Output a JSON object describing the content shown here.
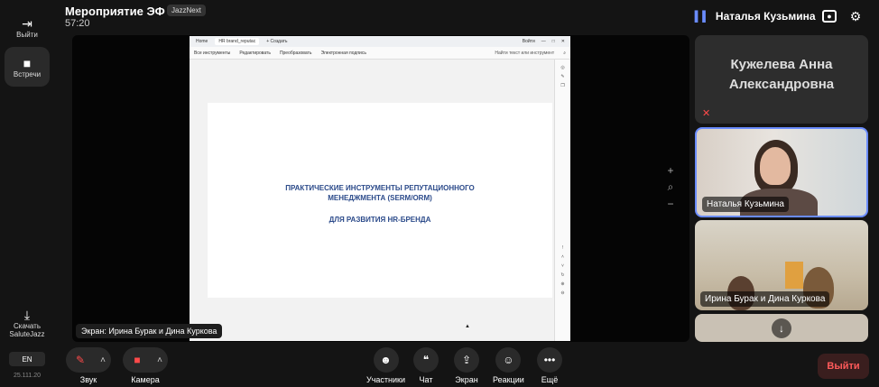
{
  "sidebar": {
    "exit_label": "Выйти",
    "meetings_label": "Встречи",
    "download_label": "Скачать SaluteJazz",
    "language": "EN",
    "version": "25.111.20"
  },
  "header": {
    "title": "Мероприятие ЭФ МГУ",
    "badge": "JazzNext",
    "timer": "57:20",
    "active_speaker": "Наталья Кузьмина"
  },
  "screen_share": {
    "label": "Экран: Ирина Бурак и Дина Куркова",
    "browser": {
      "tabs": [
        "Home",
        "HR brand_reputac",
        "+ Создать"
      ],
      "signin": "Войти",
      "toolbar": [
        "Все инструменты",
        "Редактировать",
        "Преобразовать",
        "Электронная подпись"
      ],
      "search_placeholder": "Найти текст или инструмент"
    },
    "slide": {
      "line1": "ПРАКТИЧЕСКИЕ ИНСТРУМЕНТЫ РЕПУТАЦИОННОГО",
      "line2": "МЕНЕДЖМЕНТА (SERM/ORM)",
      "line3": "ДЛЯ РАЗВИТИЯ HR-БРЕНДА"
    }
  },
  "participants": [
    {
      "name": "Кужелева Анна Александровна",
      "mic": "muted"
    },
    {
      "name": "Наталья Кузьмина"
    },
    {
      "name": "Ирина Бурак и Дина Куркова"
    }
  ],
  "controls": {
    "sound": "Звук",
    "camera": "Камера",
    "participants": "Участники",
    "chat": "Чат",
    "screen": "Экран",
    "reactions": "Реакции",
    "more": "Ещё",
    "exit": "Выйти"
  },
  "colors": {
    "accent": "#6a8cff",
    "danger": "#ff4a4a",
    "background": "#141414"
  }
}
